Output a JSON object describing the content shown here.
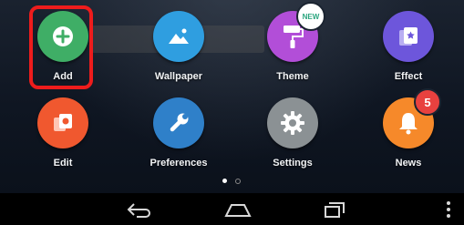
{
  "apps": [
    {
      "label": "Add",
      "icon": "plus-icon",
      "color": "#3fae66"
    },
    {
      "label": "Wallpaper",
      "icon": "image-icon",
      "color": "#2f9ee0"
    },
    {
      "label": "Theme",
      "icon": "paint-roller-icon",
      "color": "#b24ed8",
      "badge": "NEW"
    },
    {
      "label": "Effect",
      "icon": "effect-cards-icon",
      "color": "#6d56db"
    },
    {
      "label": "Edit",
      "icon": "edit-icon",
      "color": "#f0582f"
    },
    {
      "label": "Preferences",
      "icon": "wrench-icon",
      "color": "#2f80c9"
    },
    {
      "label": "Settings",
      "icon": "gear-icon",
      "color": "#8b9194"
    },
    {
      "label": "News",
      "icon": "bell-icon",
      "color": "#f6892a",
      "badge": "5"
    }
  ],
  "page_indicator": {
    "total": 2,
    "active": 1
  },
  "navigation": [
    "back-icon",
    "home-icon",
    "recent-apps-icon",
    "menu-icon"
  ],
  "highlight_color": "#ee1c1c"
}
